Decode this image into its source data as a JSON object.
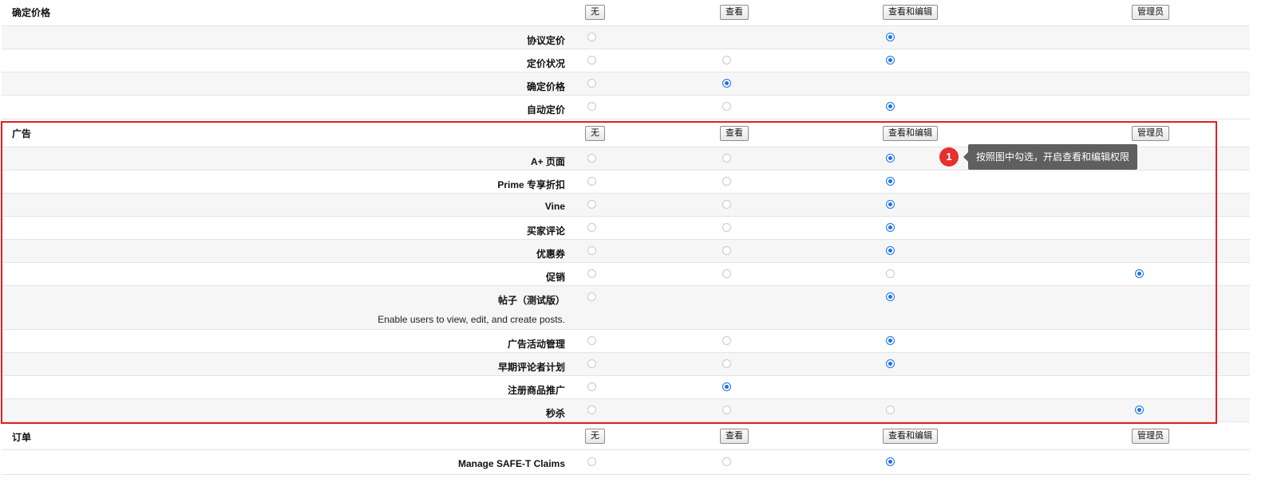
{
  "header_buttons": {
    "none": "无",
    "view": "查看",
    "view_edit": "查看和编辑",
    "admin": "管理员"
  },
  "groups": [
    {
      "title": "确定价格",
      "permissions": [
        {
          "label": "协议定价",
          "selected": "view_edit",
          "available": [
            "none",
            "view_edit"
          ]
        },
        {
          "label": "定价状况",
          "selected": "view_edit",
          "available": [
            "none",
            "view",
            "view_edit"
          ]
        },
        {
          "label": "确定价格",
          "selected": "view",
          "available": [
            "none",
            "view"
          ]
        },
        {
          "label": "自动定价",
          "selected": "view_edit",
          "available": [
            "none",
            "view",
            "view_edit"
          ]
        }
      ]
    },
    {
      "title": "广告",
      "permissions": [
        {
          "label": "A+ 页面",
          "selected": "view_edit",
          "available": [
            "none",
            "view",
            "view_edit"
          ]
        },
        {
          "label": "Prime 专享折扣",
          "selected": "view_edit",
          "available": [
            "none",
            "view",
            "view_edit"
          ]
        },
        {
          "label": "Vine",
          "selected": "view_edit",
          "available": [
            "none",
            "view",
            "view_edit"
          ]
        },
        {
          "label": "买家评论",
          "selected": "view_edit",
          "available": [
            "none",
            "view",
            "view_edit"
          ]
        },
        {
          "label": "优惠券",
          "selected": "view_edit",
          "available": [
            "none",
            "view",
            "view_edit"
          ]
        },
        {
          "label": "促销",
          "selected": "admin",
          "available": [
            "none",
            "view",
            "view_edit",
            "admin"
          ]
        },
        {
          "label": "帖子（测试版）",
          "description": "Enable users to view, edit, and create posts.",
          "selected": "view_edit",
          "available": [
            "none",
            "view_edit"
          ]
        },
        {
          "label": "广告活动管理",
          "selected": "view_edit",
          "available": [
            "none",
            "view",
            "view_edit"
          ]
        },
        {
          "label": "早期评论者计划",
          "selected": "view_edit",
          "available": [
            "none",
            "view",
            "view_edit"
          ]
        },
        {
          "label": "注册商品推广",
          "selected": "view",
          "available": [
            "none",
            "view"
          ]
        },
        {
          "label": "秒杀",
          "selected": "admin",
          "available": [
            "none",
            "view",
            "view_edit",
            "admin"
          ]
        }
      ]
    },
    {
      "title": "订单",
      "permissions": [
        {
          "label": "Manage SAFE-T Claims",
          "selected": "view_edit",
          "available": [
            "none",
            "view",
            "view_edit"
          ]
        }
      ]
    }
  ],
  "annotation": {
    "step": "1",
    "text": "按照图中勾选，开启查看和编辑权限"
  },
  "colors": {
    "accent": "#1a73e8",
    "highlight_frame": "#e02020",
    "badge": "#e63030",
    "tooltip_bg": "#5f5f5f"
  }
}
